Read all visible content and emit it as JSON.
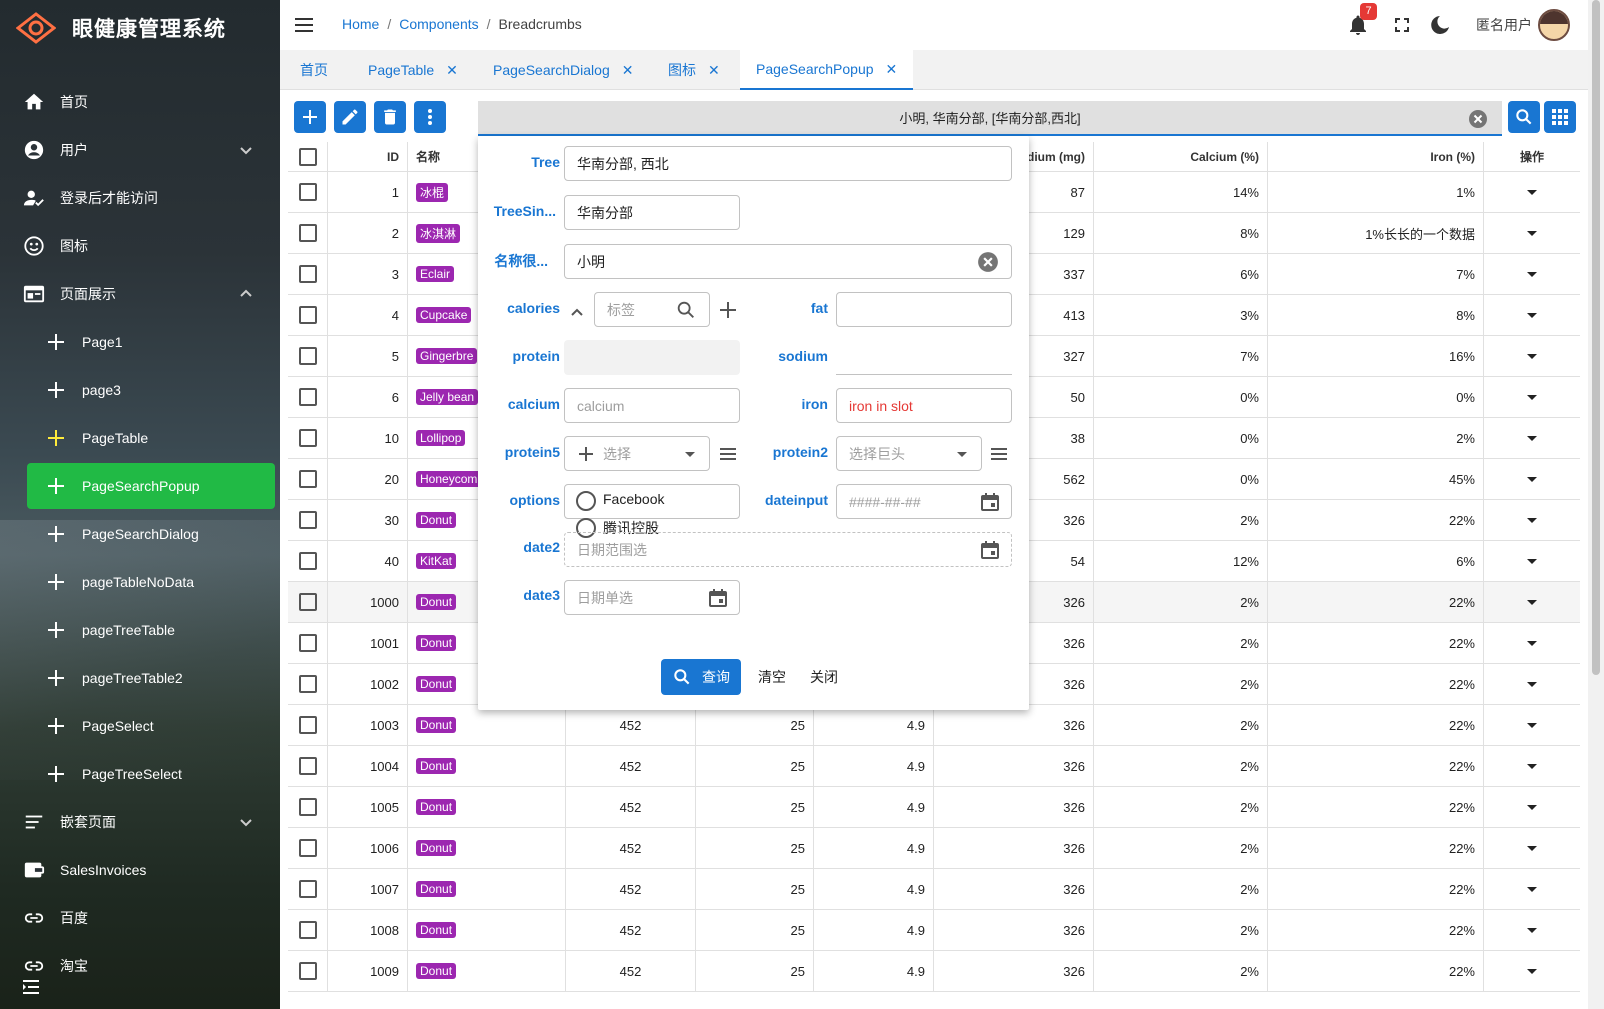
{
  "app": {
    "title": "眼健康管理系统"
  },
  "sidebar": {
    "items": [
      {
        "label": "首页",
        "icon": "home-icon"
      },
      {
        "label": "用户",
        "icon": "account-circle-icon"
      },
      {
        "label": "登录后才能访问",
        "icon": "person-check-icon"
      },
      {
        "label": "图标",
        "icon": "smiley-icon"
      },
      {
        "label": "页面展示",
        "icon": "web-icon"
      },
      {
        "label": "Page1",
        "icon": "plus-icon"
      },
      {
        "label": "page3",
        "icon": "plus-icon"
      },
      {
        "label": "PageTable",
        "icon": "plus-icon"
      },
      {
        "label": "PageSearchPopup",
        "icon": "plus-icon"
      },
      {
        "label": "PageSearchDialog",
        "icon": "plus-icon"
      },
      {
        "label": "pageTableNoData",
        "icon": "plus-icon"
      },
      {
        "label": "pageTreeTable",
        "icon": "plus-icon"
      },
      {
        "label": "pageTreeTable2",
        "icon": "plus-icon"
      },
      {
        "label": "PageSelect",
        "icon": "plus-icon"
      },
      {
        "label": "PageTreeSelect",
        "icon": "plus-icon"
      },
      {
        "label": "嵌套页面",
        "icon": "nested-list-icon"
      },
      {
        "label": "SalesInvoices",
        "icon": "wallet-icon"
      },
      {
        "label": "百度",
        "icon": "link-icon"
      },
      {
        "label": "淘宝",
        "icon": "link-icon"
      }
    ],
    "active_color": "#21ba45"
  },
  "header": {
    "breadcrumbs": [
      "Home",
      "Components",
      "Breadcrumbs"
    ],
    "notification_count": "7",
    "username": "匿名用户"
  },
  "tabs": [
    {
      "label": "首页",
      "closable": false
    },
    {
      "label": "PageTable",
      "closable": true
    },
    {
      "label": "PageSearchDialog",
      "closable": true
    },
    {
      "label": "图标",
      "closable": true
    },
    {
      "label": "PageSearchPopup",
      "closable": true,
      "active": true
    }
  ],
  "search": {
    "value": "小明, 华南分部, [华南分部,西北]"
  },
  "table": {
    "headers": [
      "ID",
      "名称",
      "",
      "",
      "",
      "dium (mg)",
      "Calcium (%)",
      "Iron (%)",
      "操作"
    ],
    "rows": [
      {
        "id": "1",
        "name": "冰棍",
        "c1": "",
        "c2": "",
        "c3": "",
        "sodium": "87",
        "calcium": "14%",
        "iron": "1%"
      },
      {
        "id": "2",
        "name": "冰淇淋",
        "c1": "",
        "c2": "",
        "c3": "",
        "sodium": "129",
        "calcium": "8%",
        "iron": "1%长长的一个数据"
      },
      {
        "id": "3",
        "name": "Eclair",
        "c1": "",
        "c2": "",
        "c3": "",
        "sodium": "337",
        "calcium": "6%",
        "iron": "7%"
      },
      {
        "id": "4",
        "name": "Cupcake",
        "c1": "",
        "c2": "",
        "c3": "",
        "sodium": "413",
        "calcium": "3%",
        "iron": "8%"
      },
      {
        "id": "5",
        "name": "Gingerbre",
        "c1": "",
        "c2": "",
        "c3": "",
        "sodium": "327",
        "calcium": "7%",
        "iron": "16%"
      },
      {
        "id": "6",
        "name": "Jelly bean",
        "c1": "",
        "c2": "",
        "c3": "",
        "sodium": "50",
        "calcium": "0%",
        "iron": "0%"
      },
      {
        "id": "10",
        "name": "Lollipop",
        "c1": "",
        "c2": "",
        "c3": "",
        "sodium": "38",
        "calcium": "0%",
        "iron": "2%"
      },
      {
        "id": "20",
        "name": "Honeycom",
        "c1": "",
        "c2": "",
        "c3": "",
        "sodium": "562",
        "calcium": "0%",
        "iron": "45%"
      },
      {
        "id": "30",
        "name": "Donut",
        "c1": "",
        "c2": "",
        "c3": "",
        "sodium": "326",
        "calcium": "2%",
        "iron": "22%"
      },
      {
        "id": "40",
        "name": "KitKat",
        "c1": "",
        "c2": "",
        "c3": "",
        "sodium": "54",
        "calcium": "12%",
        "iron": "6%"
      },
      {
        "id": "1000",
        "name": "Donut",
        "c1": "",
        "c2": "",
        "c3": "",
        "sodium": "326",
        "calcium": "2%",
        "iron": "22%"
      },
      {
        "id": "1001",
        "name": "Donut",
        "c1": "",
        "c2": "",
        "c3": "",
        "sodium": "326",
        "calcium": "2%",
        "iron": "22%"
      },
      {
        "id": "1002",
        "name": "Donut",
        "c1": "",
        "c2": "",
        "c3": "",
        "sodium": "326",
        "calcium": "2%",
        "iron": "22%"
      },
      {
        "id": "1003",
        "name": "Donut",
        "c1": "452",
        "c2": "25",
        "c3": "4.9",
        "sodium": "326",
        "calcium": "2%",
        "iron": "22%"
      },
      {
        "id": "1004",
        "name": "Donut",
        "c1": "452",
        "c2": "25",
        "c3": "4.9",
        "sodium": "326",
        "calcium": "2%",
        "iron": "22%"
      },
      {
        "id": "1005",
        "name": "Donut",
        "c1": "452",
        "c2": "25",
        "c3": "4.9",
        "sodium": "326",
        "calcium": "2%",
        "iron": "22%"
      },
      {
        "id": "1006",
        "name": "Donut",
        "c1": "452",
        "c2": "25",
        "c3": "4.9",
        "sodium": "326",
        "calcium": "2%",
        "iron": "22%"
      },
      {
        "id": "1007",
        "name": "Donut",
        "c1": "452",
        "c2": "25",
        "c3": "4.9",
        "sodium": "326",
        "calcium": "2%",
        "iron": "22%"
      },
      {
        "id": "1008",
        "name": "Donut",
        "c1": "452",
        "c2": "25",
        "c3": "4.9",
        "sodium": "326",
        "calcium": "2%",
        "iron": "22%"
      },
      {
        "id": "1009",
        "name": "Donut",
        "c1": "452",
        "c2": "25",
        "c3": "4.9",
        "sodium": "326",
        "calcium": "2%",
        "iron": "22%"
      }
    ]
  },
  "popup": {
    "tree_label": "Tree",
    "tree_value": "华南分部, 西北",
    "treesingle_label": "TreeSin...",
    "treesingle_value": "华南分部",
    "name_label": "名称很...",
    "name_value": "小明",
    "calories_label": "calories",
    "calories_placeholder": "标签",
    "fat_label": "fat",
    "protein_label": "protein",
    "sodium_label": "sodium",
    "calcium_label": "calcium",
    "calcium_placeholder": "calcium",
    "iron_label": "iron",
    "iron_value": "iron in slot",
    "protein5_label": "protein5",
    "protein5_placeholder": "选择",
    "protein2_label": "protein2",
    "protein2_placeholder": "选择巨头",
    "options_label": "options",
    "option_1": "Facebook",
    "option_2": "腾讯控股",
    "dateinput_label": "dateinput",
    "dateinput_placeholder": "####-##-##",
    "date2_label": "date2",
    "date2_placeholder": "日期范围选",
    "date3_label": "date3",
    "date3_placeholder": "日期单选",
    "query_button": "查询",
    "clear_button": "清空",
    "close_button": "关闭"
  }
}
